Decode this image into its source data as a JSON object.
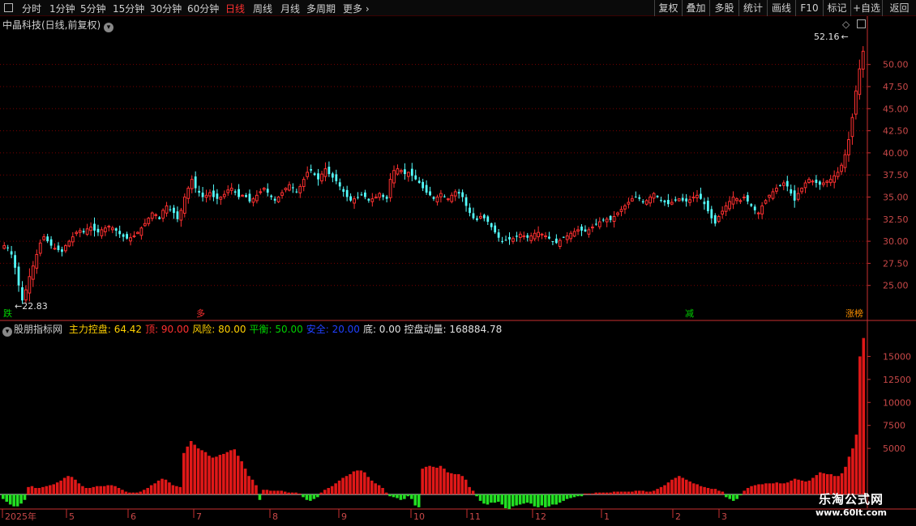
{
  "toolbar": {
    "periods": [
      "分时",
      "1分钟",
      "5分钟",
      "15分钟",
      "30分钟",
      "60分钟",
      "日线",
      "周线",
      "月线",
      "多周期",
      "更多"
    ],
    "active_period": "日线",
    "more_chevron": "chevron-right-icon",
    "buttons": [
      "复权",
      "叠加",
      "多股",
      "统计",
      "画线",
      "F10",
      "标记",
      "+自选",
      "返回"
    ]
  },
  "main_panel": {
    "title": "中晶科技(日线,前复权)",
    "title_icon": "chevron-down-icon",
    "high_label": "52.16",
    "low_label": "22.83",
    "signals": [
      {
        "label": "跌",
        "color": "#00d000"
      },
      {
        "label": "多",
        "color": "#ff3030"
      },
      {
        "label": "减",
        "color": "#00d000"
      },
      {
        "label": "涨榜",
        "color": "#ff9000"
      }
    ],
    "icons": [
      "diamond-icon",
      "window-toggle-icon"
    ]
  },
  "indicator_panel": {
    "name": "股朋指标网",
    "params": [
      {
        "label": "主力控盘: 64.42",
        "color": "#ffd000"
      },
      {
        "label": "顶: 90.00",
        "color": "#ff3030"
      },
      {
        "label": "风险: 80.00",
        "color": "#ffd000"
      },
      {
        "label": "平衡: 50.00",
        "color": "#00d000"
      },
      {
        "label": "安全: 20.00",
        "color": "#2040ff"
      },
      {
        "label": "底: 0.00",
        "color": "#e0e0e0"
      },
      {
        "label": "控盘动量: 168884.78",
        "color": "#e0e0e0"
      }
    ]
  },
  "colors": {
    "up": "#ff3030",
    "down": "#54ffff",
    "bar_up": "#e01818",
    "bar_down": "#22e022",
    "grid": "#7a0000",
    "axis": "#c83030"
  },
  "chart_data": [
    {
      "type": "candlestick",
      "title": "中晶科技(日线,前复权)",
      "x_dates": [
        "2025年",
        "5",
        "6",
        "7",
        "8",
        "9",
        "10",
        "11",
        "12",
        "1",
        "2",
        "3"
      ],
      "ylim": [
        22.5,
        54
      ],
      "y_ticks": [
        "50.00",
        "47.50",
        "45.00",
        "42.50",
        "40.00",
        "37.50",
        "35.00",
        "32.50",
        "30.00",
        "27.50",
        "25.00"
      ],
      "y_tick_values": [
        50,
        47.5,
        45,
        42.5,
        40,
        37.5,
        35,
        32.5,
        30,
        27.5,
        25
      ],
      "close_path": [
        29.5,
        29.2,
        28.5,
        27.0,
        25.0,
        23.3,
        24.5,
        26.0,
        27.2,
        28.5,
        29.8,
        30.5,
        30.0,
        29.5,
        29.2,
        29.0,
        28.8,
        29.5,
        30.0,
        30.5,
        31.0,
        31.2,
        31.0,
        31.4,
        31.6,
        31.2,
        31.0,
        31.3,
        31.5,
        31.7,
        31.5,
        31.2,
        30.8,
        30.5,
        30.3,
        30.4,
        30.6,
        31.0,
        31.5,
        32.0,
        32.6,
        33.2,
        33.0,
        32.5,
        33.5,
        34.0,
        33.6,
        33.2,
        32.5,
        33.5,
        35.0,
        36.0,
        37.0,
        36.0,
        35.5,
        35.0,
        35.2,
        35.5,
        35.0,
        34.8,
        35.0,
        35.3,
        35.8,
        36.0,
        35.5,
        35.0,
        35.2,
        35.0,
        34.5,
        34.8,
        35.2,
        35.6,
        36.0,
        35.5,
        35.0,
        34.6,
        35.0,
        35.5,
        36.0,
        36.4,
        36.0,
        35.6,
        36.2,
        37.0,
        37.8,
        38.0,
        37.5,
        37.0,
        37.6,
        38.2,
        37.6,
        37.2,
        36.8,
        36.2,
        35.6,
        35.0,
        34.6,
        34.8,
        35.0,
        35.2,
        35.0,
        34.6,
        34.8,
        35.0,
        35.4,
        35.0,
        34.8,
        37.0,
        38.0,
        38.2,
        38.0,
        37.6,
        37.8,
        37.4,
        37.0,
        36.6,
        36.0,
        35.5,
        35.2,
        34.8,
        35.0,
        35.4,
        35.0,
        34.8,
        35.2,
        35.6,
        35.4,
        35.0,
        34.0,
        33.2,
        32.6,
        32.4,
        32.8,
        32.6,
        32.2,
        31.6,
        31.0,
        30.4,
        30.0,
        30.1,
        30.2,
        30.3,
        30.5,
        30.8,
        30.6,
        30.4,
        30.6,
        30.9,
        31.0,
        30.8,
        30.6,
        30.3,
        30.0,
        29.8,
        30.1,
        30.4,
        30.6,
        30.9,
        31.1,
        31.3,
        31.2,
        31.1,
        31.3,
        31.6,
        31.9,
        32.2,
        32.4,
        32.5,
        32.4,
        32.8,
        33.2,
        33.6,
        34.0,
        34.4,
        34.8,
        35.0,
        34.8,
        34.4,
        34.6,
        35.0,
        35.4,
        35.0,
        34.6,
        34.4,
        34.2,
        34.4,
        34.6,
        34.8,
        34.6,
        34.5,
        34.7,
        35.0,
        35.2,
        34.8,
        34.2,
        33.4,
        32.6,
        32.0,
        32.8,
        33.4,
        34.0,
        34.5,
        35.0,
        34.8,
        34.6,
        35.0,
        34.5,
        34.0,
        33.5,
        33.2,
        34.0,
        34.6,
        35.2,
        35.6,
        36.0,
        36.3,
        36.6,
        36.2,
        35.4,
        34.6,
        35.4,
        36.0,
        36.6,
        37.0,
        36.8,
        36.6,
        36.4,
        36.6,
        36.8,
        37.0,
        37.4,
        37.8,
        38.6,
        39.8,
        41.5,
        44.0,
        47.0,
        49.5,
        51.5
      ],
      "high_value": 52.16,
      "low_value": 22.83
    },
    {
      "type": "bar",
      "title": "股朋指标网",
      "ylim": [
        -1500,
        17500
      ],
      "y_ticks": [
        "15000",
        "12500",
        "10000",
        "7500",
        "5000"
      ],
      "y_tick_values": [
        15000,
        12500,
        10000,
        7500,
        5000
      ],
      "values": [
        -500,
        -800,
        -1100,
        -1300,
        -1300,
        -1000,
        -600,
        800,
        900,
        700,
        700,
        800,
        900,
        1000,
        1100,
        1300,
        1500,
        1800,
        2000,
        1900,
        1600,
        1200,
        900,
        700,
        700,
        800,
        900,
        900,
        900,
        1000,
        1000,
        900,
        700,
        500,
        300,
        200,
        200,
        200,
        300,
        500,
        700,
        1000,
        1200,
        1500,
        1700,
        1600,
        1300,
        1000,
        900,
        800,
        4500,
        5200,
        5800,
        5400,
        5000,
        4800,
        4600,
        4200,
        4000,
        4100,
        4300,
        4400,
        4600,
        4800,
        4900,
        4200,
        3600,
        2800,
        2000,
        1600,
        1000,
        -600,
        500,
        500,
        400,
        400,
        400,
        400,
        300,
        200,
        200,
        200,
        100,
        -300,
        -600,
        -700,
        -500,
        -300,
        200,
        500,
        700,
        900,
        1200,
        1500,
        1800,
        2000,
        2200,
        2500,
        2600,
        2600,
        2400,
        1900,
        1500,
        1200,
        1000,
        700,
        200,
        -200,
        -300,
        -400,
        -600,
        -500,
        -200,
        -500,
        -1200,
        -1400,
        2800,
        3000,
        3100,
        3000,
        2900,
        3100,
        2800,
        2400,
        2300,
        2200,
        2200,
        2000,
        1600,
        800,
        400,
        -200,
        -700,
        -1000,
        -1100,
        -900,
        -900,
        -800,
        -1100,
        -1500,
        -1600,
        -1300,
        -1200,
        -1100,
        -1000,
        -900,
        -1000,
        -1300,
        -1400,
        -1200,
        -1400,
        -1300,
        -1100,
        -1100,
        -900,
        -700,
        -500,
        -400,
        -300,
        -200,
        -200,
        100,
        100,
        100,
        200,
        200,
        200,
        200,
        200,
        300,
        300,
        300,
        300,
        300,
        300,
        400,
        400,
        400,
        300,
        300,
        400,
        600,
        800,
        1000,
        1300,
        1600,
        1800,
        2000,
        1800,
        1600,
        1400,
        1200,
        1100,
        900,
        800,
        700,
        600,
        600,
        400,
        300,
        -300,
        -500,
        -700,
        -500,
        -100,
        400,
        700,
        900,
        1000,
        1100,
        1100,
        1200,
        1200,
        1200,
        1300,
        1200,
        1200,
        1300,
        1500,
        1700,
        1600,
        1500,
        1400,
        1500,
        1800,
        2100,
        2400,
        2300,
        2200,
        2200,
        2000,
        2000,
        2300,
        3000,
        4100,
        5000,
        6500,
        15000,
        17000
      ]
    }
  ],
  "time_axis_labels": [
    "2025年",
    "5",
    "6",
    "7",
    "8",
    "9",
    "10",
    "11",
    "12",
    "1",
    "2",
    "3"
  ],
  "watermark": {
    "title": "乐淘公式网",
    "url": "www.60lt.com"
  }
}
